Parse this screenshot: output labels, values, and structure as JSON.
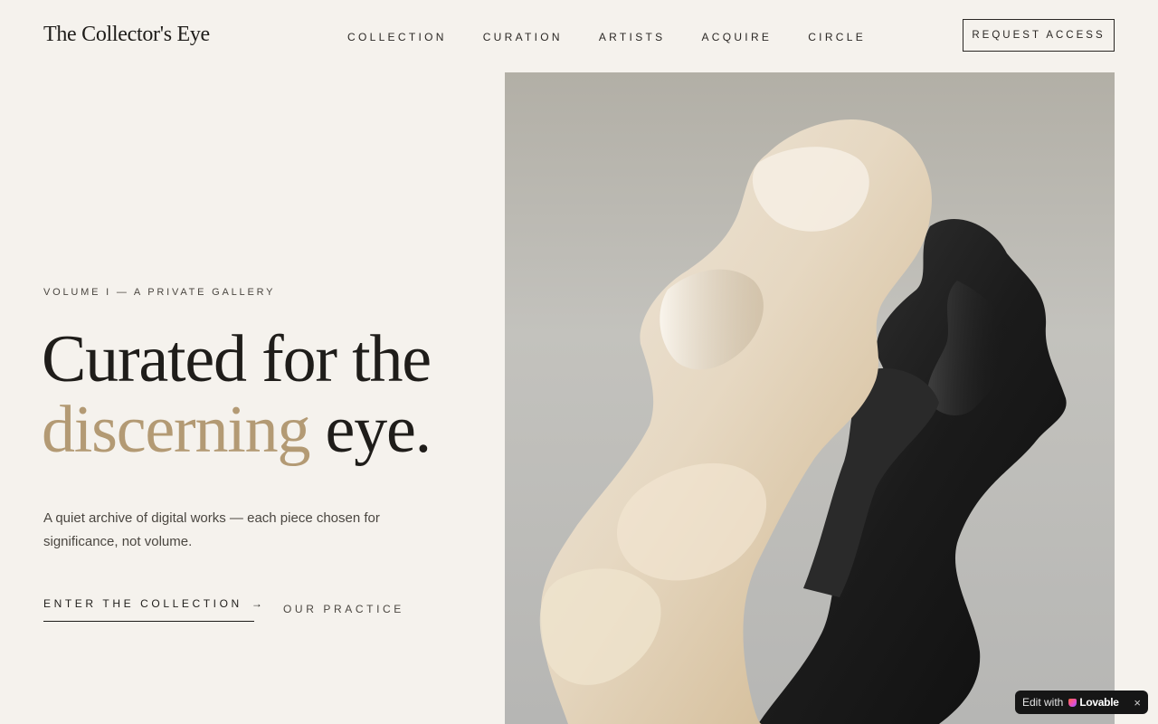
{
  "header": {
    "logo": "The Collector's Eye",
    "nav": [
      "COLLECTION",
      "CURATION",
      "ARTISTS",
      "ACQUIRE",
      "CIRCLE"
    ],
    "request_access": "REQUEST ACCESS"
  },
  "hero": {
    "eyebrow": "VOLUME I — A PRIVATE GALLERY",
    "headline_line1": "Curated for the",
    "headline_accent": "discerning",
    "headline_end": " eye.",
    "lede": "A quiet archive of digital works — each piece chosen for significance, not volume.",
    "cta_primary": "ENTER THE COLLECTION",
    "cta_primary_arrow": "→",
    "cta_secondary": "OUR PRACTICE",
    "image_subject": "flowing ivory and black silk fabric sculpture"
  },
  "badge": {
    "edit_label": "Edit with",
    "brand": "Lovable",
    "close": "×"
  },
  "colors": {
    "background": "#f5f2ed",
    "text": "#1f1d1a",
    "accent": "#b39a74"
  }
}
